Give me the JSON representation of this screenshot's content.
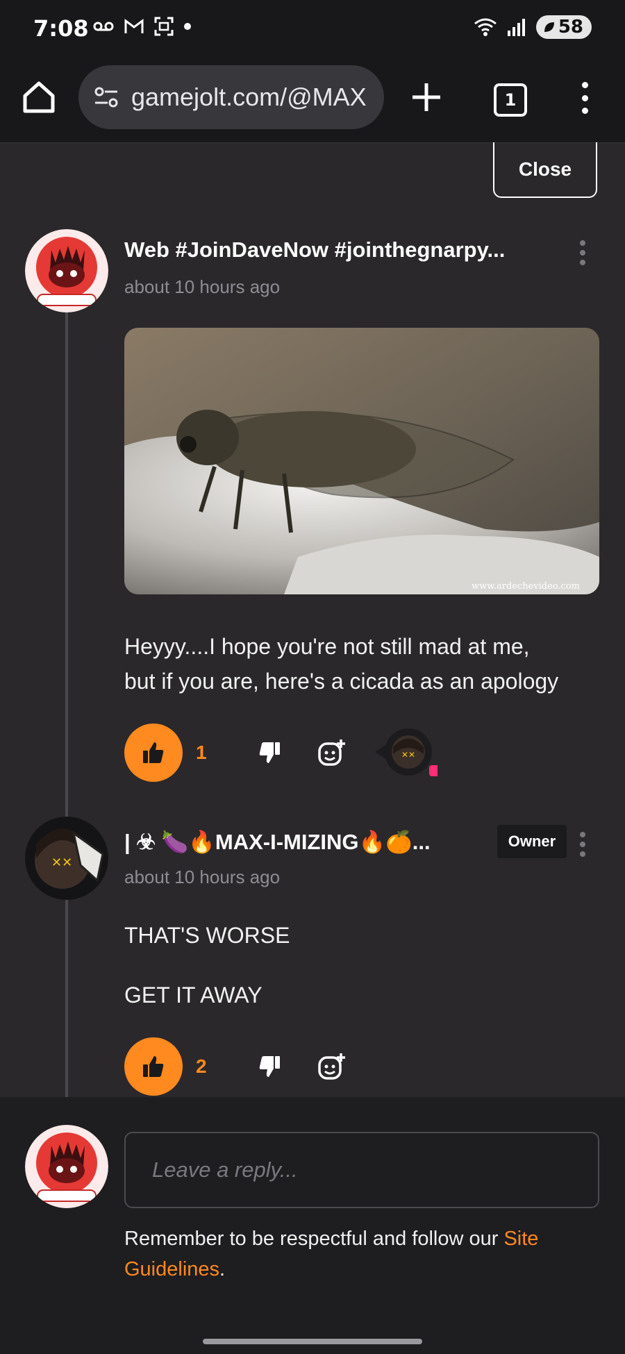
{
  "status_bar": {
    "time": "7:08",
    "battery": "58"
  },
  "browser": {
    "url": "gamejolt.com/@MAX",
    "tab_count": "1"
  },
  "close_label": "Close",
  "comments": [
    {
      "author": "Web #JoinDaveNow #jointhegnarpy...",
      "timestamp": "about 10 hours ago",
      "image_watermark": "www.ardechevideo.com",
      "body_line1": "Heyyy....I hope you're not still mad at me,",
      "body_line2": "but if you are, here's a cicada as an apology",
      "likes": "1"
    },
    {
      "author": "| ☣ 🍆🔥MAX-I-MIZING🔥🍊...",
      "badge": "Owner",
      "timestamp": "about 10 hours ago",
      "body_line1": "THAT'S WORSE",
      "body_line2": "GET IT AWAY",
      "likes": "2"
    }
  ],
  "reply": {
    "placeholder": "Leave a reply...",
    "notice_prefix": "Remember to be respectful and follow our ",
    "notice_link": "Site Guidelines",
    "notice_suffix": "."
  },
  "colors": {
    "accent": "#ff8a1f",
    "background": "#2a282b",
    "bar": "#18181b"
  }
}
